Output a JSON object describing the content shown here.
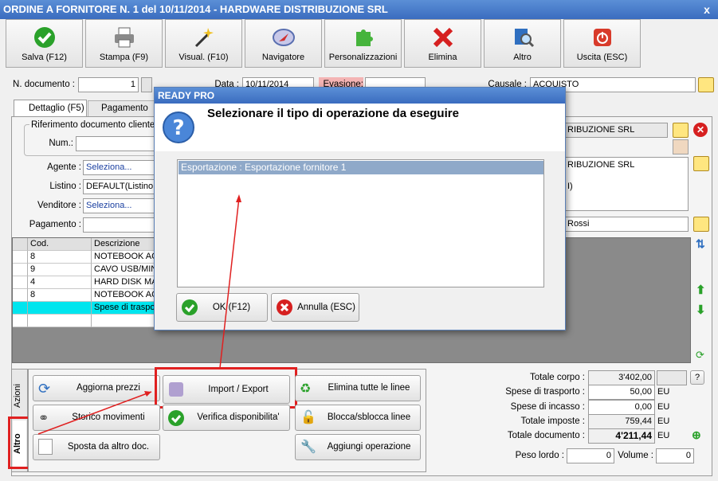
{
  "window": {
    "title": "ORDINE A FORNITORE N. 1 del 10/11/2014 - HARDWARE DISTRIBUZIONE SRL",
    "close": "x"
  },
  "toolbar": [
    {
      "label": "Salva (F12)",
      "icon": "save-check-icon",
      "color": "#2aa12a"
    },
    {
      "label": "Stampa (F9)",
      "icon": "printer-icon",
      "color": "#777777"
    },
    {
      "label": "Visual. (F10)",
      "icon": "magic-wand-icon",
      "color": "#333333"
    },
    {
      "label": "Navigatore",
      "icon": "compass-icon",
      "color": "#5a6fb0"
    },
    {
      "label": "Personalizzazioni",
      "icon": "puzzle-icon",
      "color": "#46b43c"
    },
    {
      "label": "Elimina",
      "icon": "red-x-icon",
      "color": "#d62020"
    },
    {
      "label": "Altro",
      "icon": "book-search-icon",
      "color": "#2f6fc0"
    },
    {
      "label": "Uscita (ESC)",
      "icon": "power-icon",
      "color": "#d83a2a"
    }
  ],
  "header": {
    "ndoc_label": "N. documento :",
    "ndoc_value": "1",
    "data_label": "Data :",
    "data_value": "10/11/2014",
    "evasione_label": "Evasione:",
    "causale_label": "Causale :",
    "causale_value": "ACQUISTO"
  },
  "tabs": [
    "Dettaglio (F5)",
    "Pagamento"
  ],
  "form": {
    "riferimento_label": "Riferimento documento cliente/f",
    "num_label": "Num.:",
    "agente_label": "Agente :",
    "agente_value": "Seleziona...",
    "listino_label": "Listino :",
    "listino_value": "DEFAULT(Listino a",
    "venditore_label": "Venditore :",
    "venditore_value": "Seleziona...",
    "pagamento_label": "Pagamento :"
  },
  "right": {
    "fornitore": "RIBUZIONE SRL",
    "destinazione": "RIBUZIONE SRL",
    "dest_extra": "I)",
    "operatore": "Rossi"
  },
  "grid": {
    "headers": [
      "Cod.",
      "Descrizione"
    ],
    "rows": [
      [
        "8",
        "NOTEBOOK ACE"
      ],
      [
        "9",
        "CAVO USB/MINI"
      ],
      [
        "4",
        "HARD DISK MAX"
      ],
      [
        "8",
        "NOTEBOOK ACE"
      ],
      [
        "",
        "Spese di traspo"
      ],
      [
        "",
        ""
      ]
    ]
  },
  "side_tabs": [
    "Azioni",
    "Altro"
  ],
  "actions": {
    "aggiorna": "Aggiorna prezzi",
    "import": "Import / Export",
    "elimina": "Elimina tutte le linee",
    "storico": "Storico movimenti",
    "verifica": "Verifica disponibilita'",
    "blocca": "Blocca/sblocca linee",
    "sposta": "Sposta da altro doc.",
    "aggiungi": "Aggiungi operazione"
  },
  "totals": {
    "corpo_label": "Totale corpo :",
    "corpo_value": "3'402,00",
    "trasporto_label": "Spese di trasporto :",
    "trasporto_value": "50,00",
    "incasso_label": "Spese di incasso :",
    "incasso_value": "0,00",
    "imposte_label": "Totale imposte :",
    "imposte_value": "759,44",
    "documento_label": "Totale documento :",
    "documento_value": "4'211,44",
    "currency": "EU",
    "help": "?",
    "peso_label": "Peso lordo :",
    "peso_value": "0",
    "volume_label": "Volume :",
    "volume_value": "0"
  },
  "dialog": {
    "title": "READY PRO",
    "heading": "Selezionare il tipo di operazione da eseguire",
    "item": "Esportazione : Esportazione fornitore 1",
    "ok": "OK (F12)",
    "cancel": "Annulla (ESC)"
  }
}
